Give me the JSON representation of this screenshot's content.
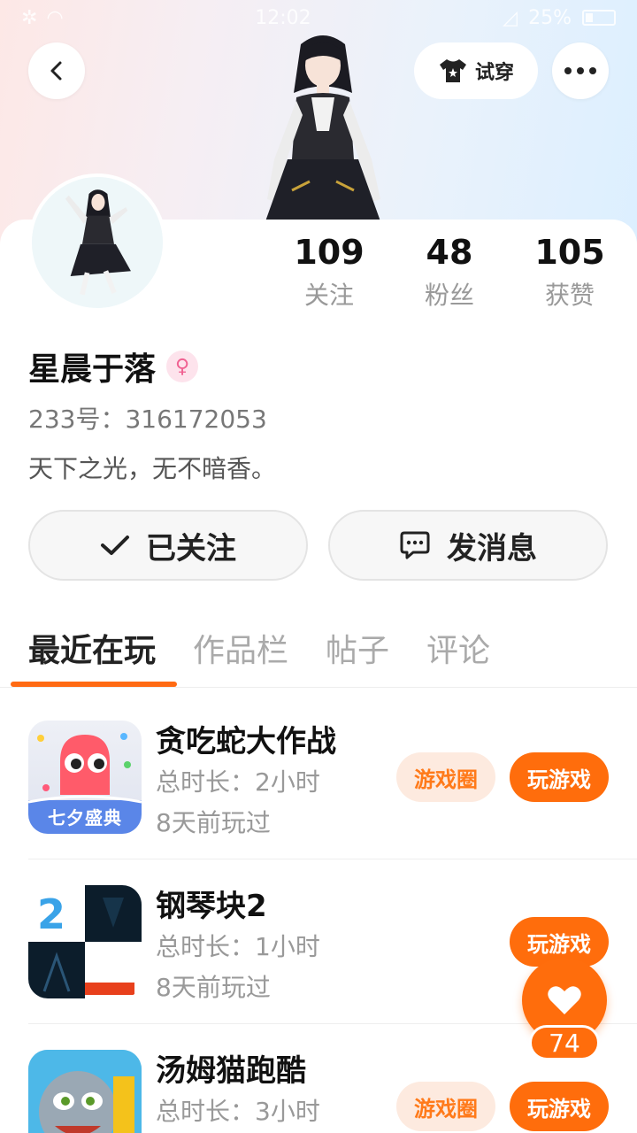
{
  "status_bar": {
    "time": "12:02",
    "battery": "25%"
  },
  "header": {
    "tryon_label": "试穿"
  },
  "profile": {
    "stats": [
      {
        "value": "109",
        "label": "关注"
      },
      {
        "value": "48",
        "label": "粉丝"
      },
      {
        "value": "105",
        "label": "获赞"
      }
    ],
    "username": "星晨于落",
    "gender_symbol": "♀",
    "uid": "233号：316172053",
    "bio": "天下之光，无不暗香。"
  },
  "actions": {
    "follow_label": "已关注",
    "message_label": "发消息"
  },
  "tabs": [
    {
      "label": "最近在玩",
      "active": true
    },
    {
      "label": "作品栏",
      "active": false
    },
    {
      "label": "帖子",
      "active": false
    },
    {
      "label": "评论",
      "active": false
    }
  ],
  "games": [
    {
      "name": "贪吃蛇大作战",
      "duration": "总时长：2小时",
      "last_played": "8天前玩过",
      "circle_label": "游戏圈",
      "play_label": "玩游戏",
      "icon_badge": "七夕盛典"
    },
    {
      "name": "钢琴块2",
      "duration": "总时长：1小时",
      "last_played": "8天前玩过",
      "play_label": "玩游戏",
      "icon_badge": "2"
    },
    {
      "name": "汤姆猫跑酷",
      "duration": "总时长：3小时",
      "circle_label": "游戏圈",
      "play_label": "玩游戏"
    }
  ],
  "like_fab": {
    "count": "74"
  },
  "colors": {
    "accent": "#ff6d0c",
    "accent_light": "#fdeadf"
  }
}
